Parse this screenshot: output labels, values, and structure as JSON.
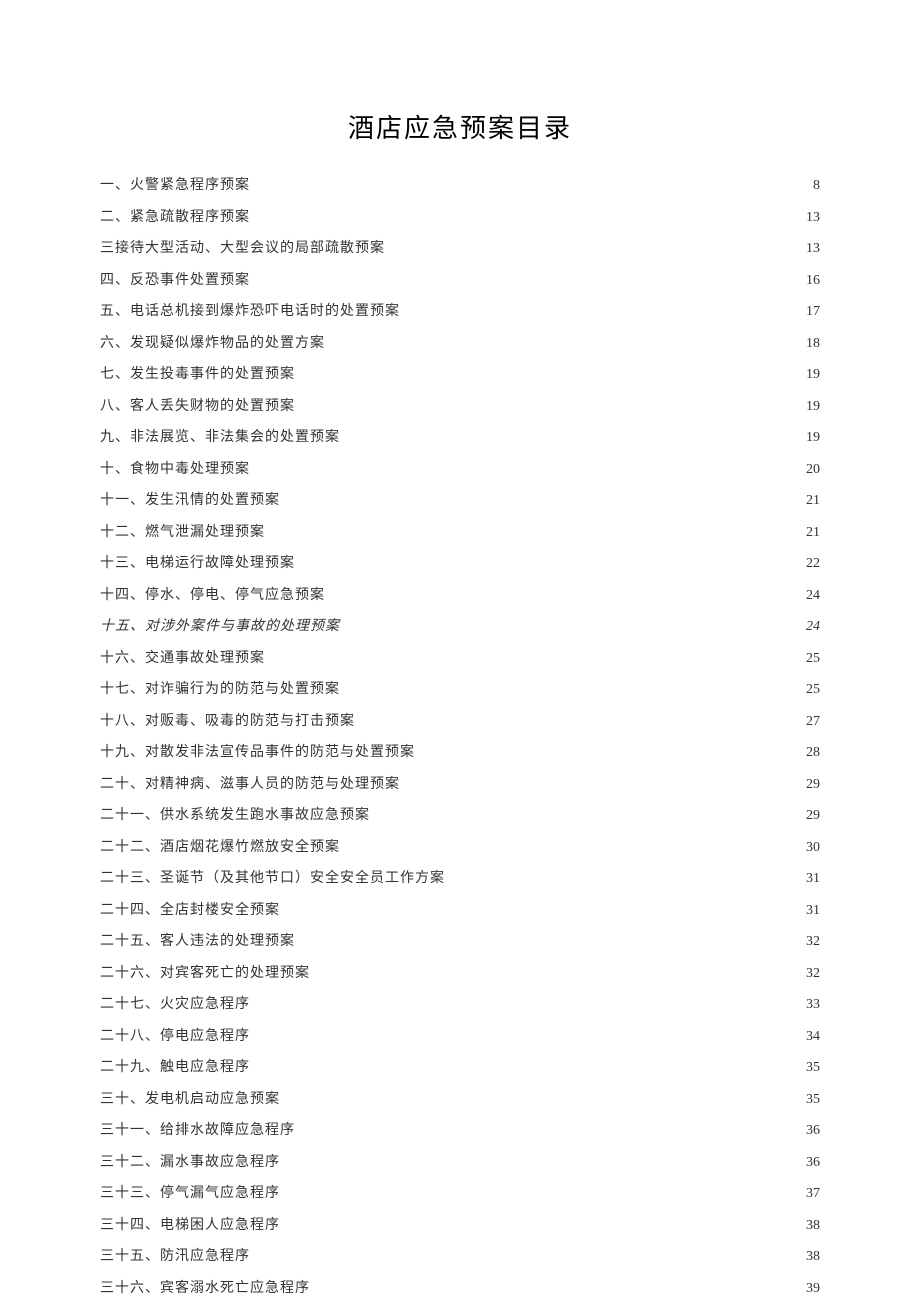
{
  "title": "酒店应急预案目录",
  "toc": [
    {
      "label": "一、火警紧急程序预案",
      "page": "8",
      "italic": false
    },
    {
      "label": "二、紧急疏散程序预案",
      "page": "13",
      "italic": false
    },
    {
      "label": "三接待大型活动、大型会议的局部疏散预案",
      "page": "13",
      "italic": false
    },
    {
      "label": "四、反恐事件处置预案",
      "page": "16",
      "italic": false
    },
    {
      "label": "五、电话总机接到爆炸恐吓电话时的处置预案",
      "page": "17",
      "italic": false
    },
    {
      "label": "六、发现疑似爆炸物品的处置方案",
      "page": "18",
      "italic": false
    },
    {
      "label": "七、发生投毒事件的处置预案",
      "page": "19",
      "italic": false
    },
    {
      "label": "八、客人丢失财物的处置预案",
      "page": "19",
      "italic": false
    },
    {
      "label": "九、非法展览、非法集会的处置预案",
      "page": "19",
      "italic": false
    },
    {
      "label": "十、食物中毒处理预案",
      "page": "20",
      "italic": false
    },
    {
      "label": "十一、发生汛情的处置预案",
      "page": "21",
      "italic": false
    },
    {
      "label": "十二、燃气泄漏处理预案",
      "page": "21",
      "italic": false
    },
    {
      "label": "十三、电梯运行故障处理预案",
      "page": "22",
      "italic": false
    },
    {
      "label": "十四、停水、停电、停气应急预案",
      "page": "24",
      "italic": false
    },
    {
      "label": "十五、对涉外案件与事故的处理预案",
      "page": "24",
      "italic": true
    },
    {
      "label": "十六、交通事故处理预案",
      "page": "25",
      "italic": false
    },
    {
      "label": "十七、对诈骗行为的防范与处置预案",
      "page": "25",
      "italic": false
    },
    {
      "label": "十八、对贩毒、吸毒的防范与打击预案",
      "page": "27",
      "italic": false
    },
    {
      "label": "十九、对散发非法宣传品事件的防范与处置预案",
      "page": "28",
      "italic": false
    },
    {
      "label": "二十、对精神病、滋事人员的防范与处理预案",
      "page": "29",
      "italic": false
    },
    {
      "label": "二十一、供水系统发生跑水事故应急预案",
      "page": "29",
      "italic": false
    },
    {
      "label": "二十二、酒店烟花爆竹燃放安全预案",
      "page": "30",
      "italic": false
    },
    {
      "label": "二十三、圣诞节（及其他节口）安全安全员工作方案",
      "page": "31",
      "italic": false
    },
    {
      "label": "二十四、全店封楼安全预案",
      "page": "31",
      "italic": false
    },
    {
      "label": "二十五、客人违法的处理预案",
      "page": "32",
      "italic": false
    },
    {
      "label": "二十六、对宾客死亡的处理预案",
      "page": "32",
      "italic": false
    },
    {
      "label": "二十七、火灾应急程序",
      "page": "33",
      "italic": false
    },
    {
      "label": "二十八、停电应急程序",
      "page": "34",
      "italic": false
    },
    {
      "label": "二十九、触电应急程序",
      "page": "35",
      "italic": false
    },
    {
      "label": "三十、发电机启动应急预案",
      "page": "35",
      "italic": false
    },
    {
      "label": "三十一、给排水故障应急程序",
      "page": "36",
      "italic": false
    },
    {
      "label": "三十二、漏水事故应急程序",
      "page": "36",
      "italic": false
    },
    {
      "label": "三十三、停气漏气应急程序",
      "page": "37",
      "italic": false
    },
    {
      "label": "三十四、电梯困人应急程序",
      "page": "38",
      "italic": false
    },
    {
      "label": "三十五、防汛应急程序",
      "page": "38",
      "italic": false
    },
    {
      "label": "三十六、宾客溺水死亡应急程序",
      "page": "39",
      "italic": false
    }
  ]
}
